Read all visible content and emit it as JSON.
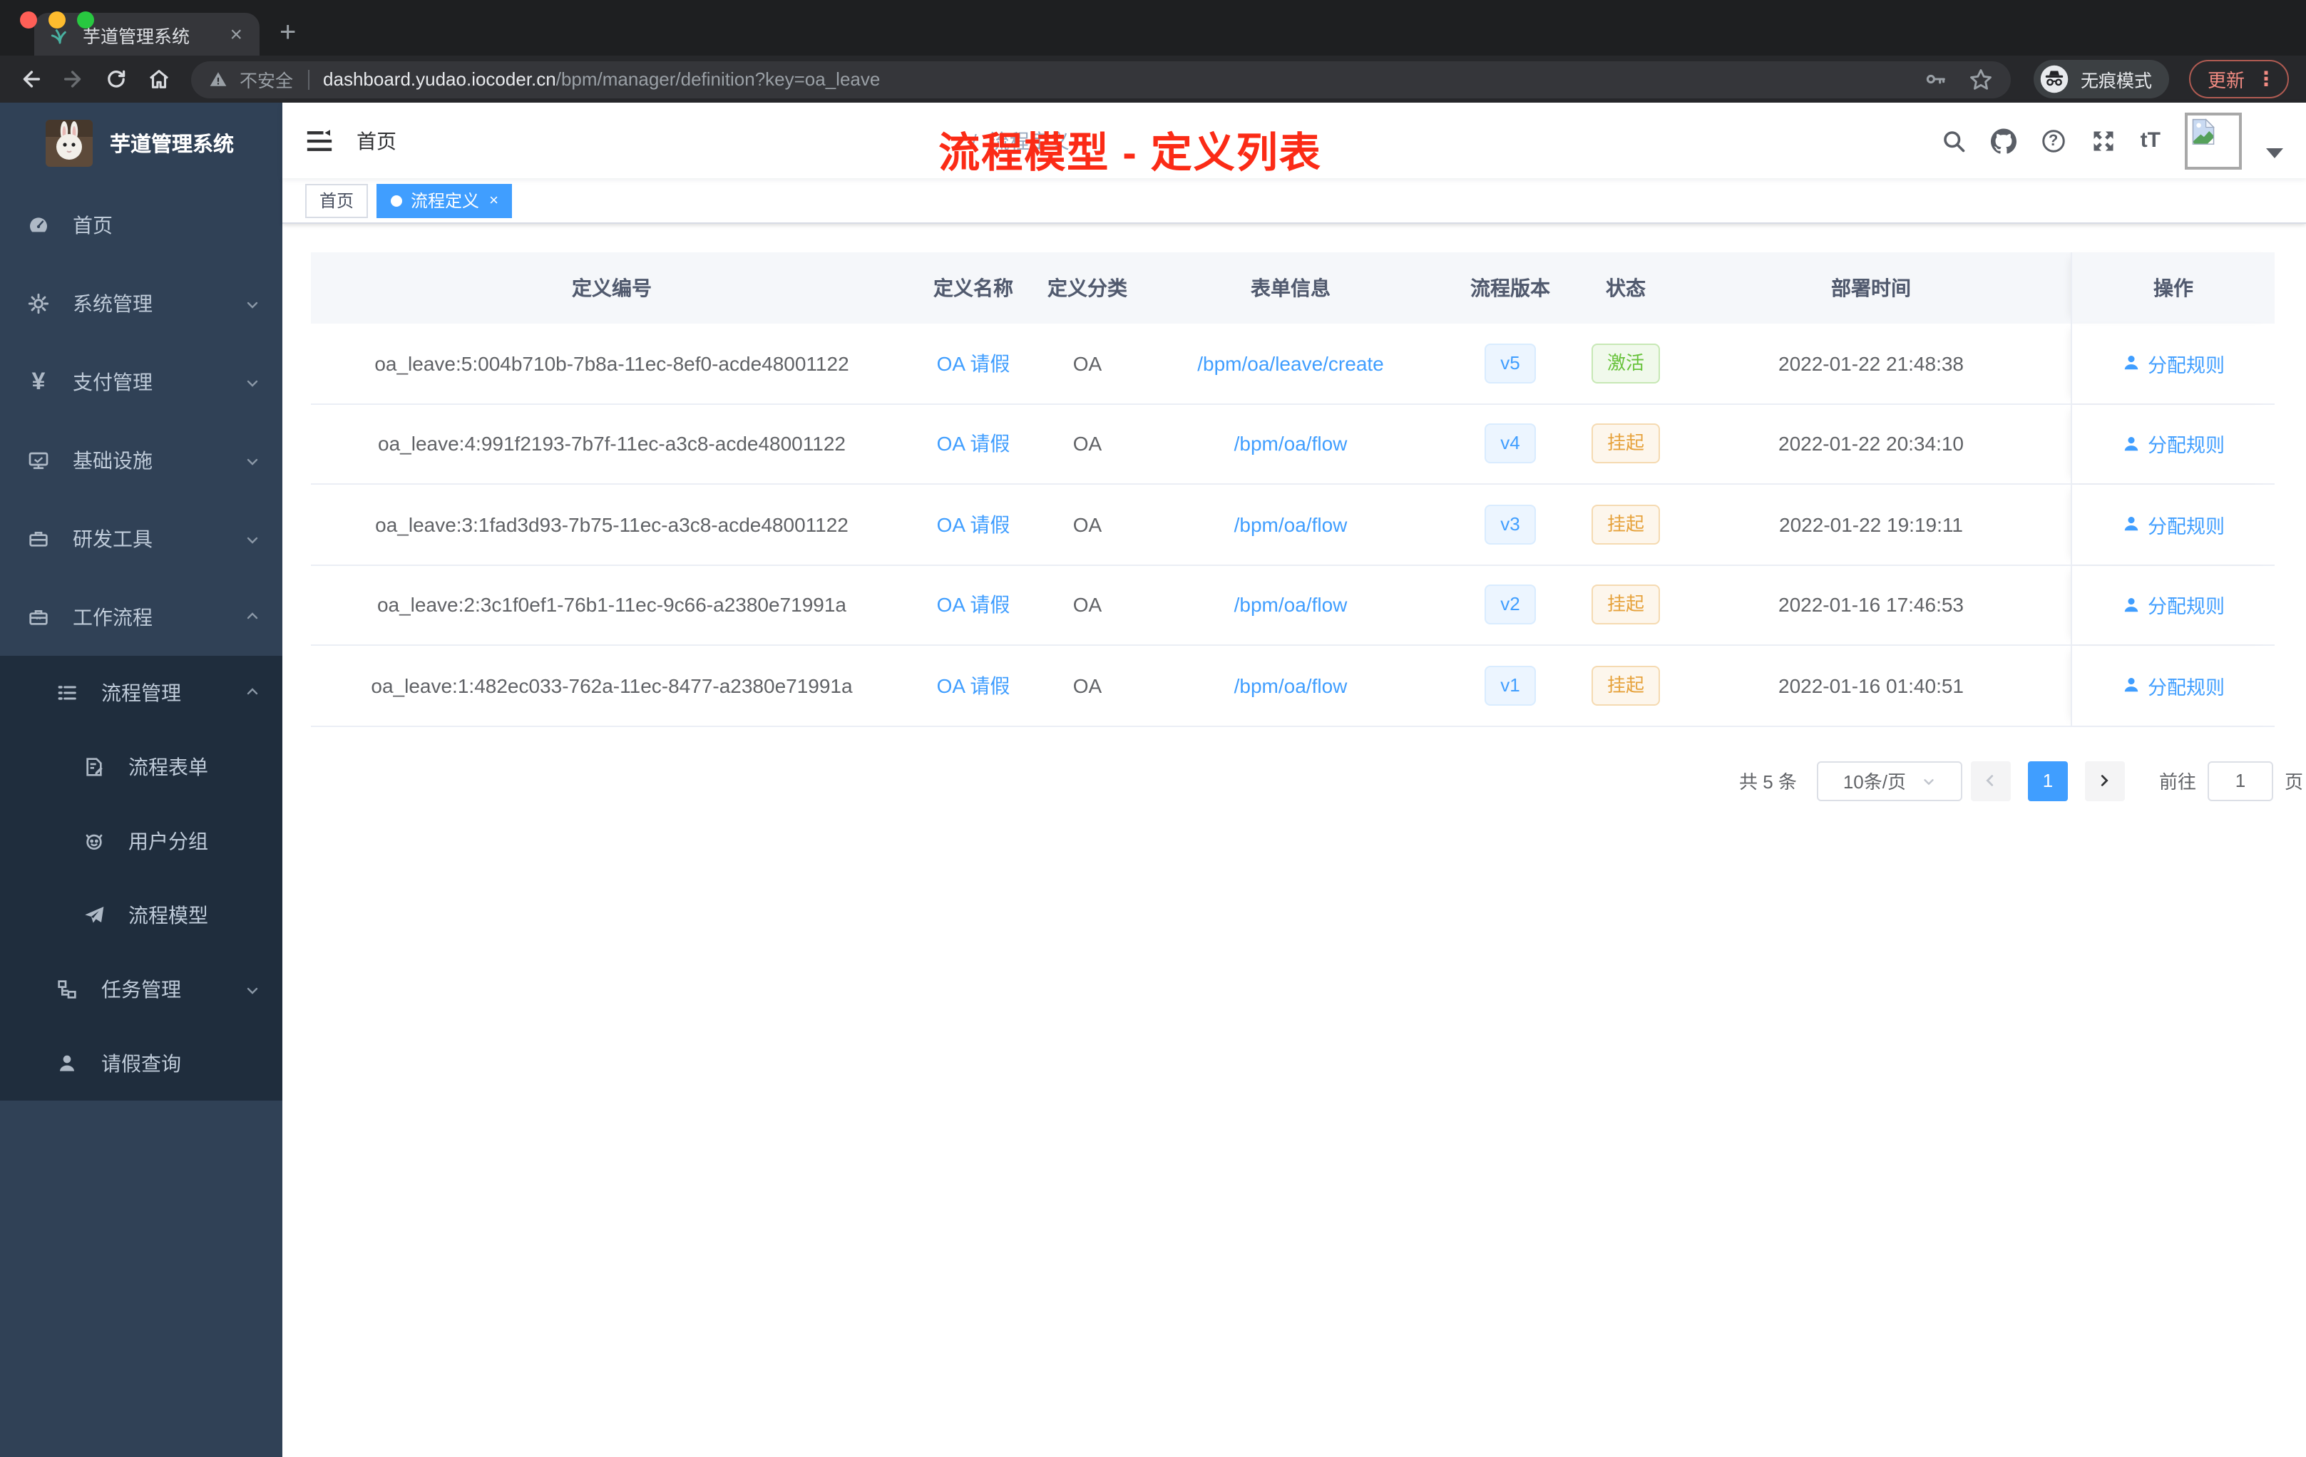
{
  "browser": {
    "tab_title": "芋道管理系统",
    "security_label": "不安全",
    "url_domain": "dashboard.yudao.iocoder.cn",
    "url_path": "/bpm/manager/definition?key=oa_leave",
    "incognito_label": "无痕模式",
    "update_label": "更新"
  },
  "glyphs": {
    "tab_close": "×",
    "new_tab": "+",
    "more": "⋮",
    "question": "?",
    "font_size": "tT",
    "tag_close": "×"
  },
  "sidebar": {
    "logo_title": "芋道管理系统",
    "items": [
      {
        "label": "首页",
        "icon": "dashboard-icon",
        "level": 1
      },
      {
        "label": "系统管理",
        "icon": "gear-icon",
        "level": 1,
        "arrow": "down"
      },
      {
        "label": "支付管理",
        "icon": "yen-icon",
        "level": 1,
        "arrow": "down",
        "glyph": "¥"
      },
      {
        "label": "基础设施",
        "icon": "monitor-icon",
        "level": 1,
        "arrow": "down"
      },
      {
        "label": "研发工具",
        "icon": "toolbox-icon",
        "level": 1,
        "arrow": "down"
      },
      {
        "label": "工作流程",
        "icon": "briefcase-icon",
        "level": 1,
        "arrow": "up"
      },
      {
        "label": "流程管理",
        "icon": "list-icon",
        "level": 2,
        "arrow": "up"
      },
      {
        "label": "流程表单",
        "icon": "form-icon",
        "level": 3
      },
      {
        "label": "用户分组",
        "icon": "robot-icon",
        "level": 3
      },
      {
        "label": "流程模型",
        "icon": "paper-plane-icon",
        "level": 3
      },
      {
        "label": "任务管理",
        "icon": "tree-icon",
        "level": 2,
        "arrow": "down"
      },
      {
        "label": "请假查询",
        "icon": "user-icon",
        "level": 2
      }
    ]
  },
  "header": {
    "breadcrumb": [
      "首页",
      "流程定义"
    ],
    "separator": "/",
    "annotation": "流程模型 - 定义列表"
  },
  "tags": [
    {
      "label": "首页",
      "active": false
    },
    {
      "label": "流程定义",
      "active": true
    }
  ],
  "table": {
    "columns": [
      "定义编号",
      "定义名称",
      "定义分类",
      "表单信息",
      "流程版本",
      "状态",
      "部署时间",
      "操作"
    ],
    "action_label": "分配规则",
    "rows": [
      {
        "id": "oa_leave:5:004b710b-7b8a-11ec-8ef0-acde48001122",
        "name": "OA 请假",
        "category": "OA",
        "form": "/bpm/oa/leave/create",
        "version": "v5",
        "status": "激活",
        "time": "2022-01-22 21:48:38"
      },
      {
        "id": "oa_leave:4:991f2193-7b7f-11ec-a3c8-acde48001122",
        "name": "OA 请假",
        "category": "OA",
        "form": "/bpm/oa/flow",
        "version": "v4",
        "status": "挂起",
        "time": "2022-01-22 20:34:10"
      },
      {
        "id": "oa_leave:3:1fad3d93-7b75-11ec-a3c8-acde48001122",
        "name": "OA 请假",
        "category": "OA",
        "form": "/bpm/oa/flow",
        "version": "v3",
        "status": "挂起",
        "time": "2022-01-22 19:19:11"
      },
      {
        "id": "oa_leave:2:3c1f0ef1-76b1-11ec-9c66-a2380e71991a",
        "name": "OA 请假",
        "category": "OA",
        "form": "/bpm/oa/flow",
        "version": "v2",
        "status": "挂起",
        "time": "2022-01-16 17:46:53"
      },
      {
        "id": "oa_leave:1:482ec033-762a-11ec-8477-a2380e71991a",
        "name": "OA 请假",
        "category": "OA",
        "form": "/bpm/oa/flow",
        "version": "v1",
        "status": "挂起",
        "time": "2022-01-16 01:40:51"
      }
    ]
  },
  "pagination": {
    "total": "共 5 条",
    "page_size": "10条/页",
    "current_page": "1",
    "goto_label": "前往",
    "goto_value": "1",
    "page_unit": "页"
  },
  "colors": {
    "accent": "#409eff",
    "success": "#67c23a",
    "warning": "#e6a23c",
    "sidebar_bg": "#304156",
    "submenu_bg": "#1f2d3d",
    "annotation_red": "#fb2b16",
    "traffic_red": "#ff5f57",
    "traffic_yellow": "#febc2e",
    "traffic_green": "#28c840"
  }
}
